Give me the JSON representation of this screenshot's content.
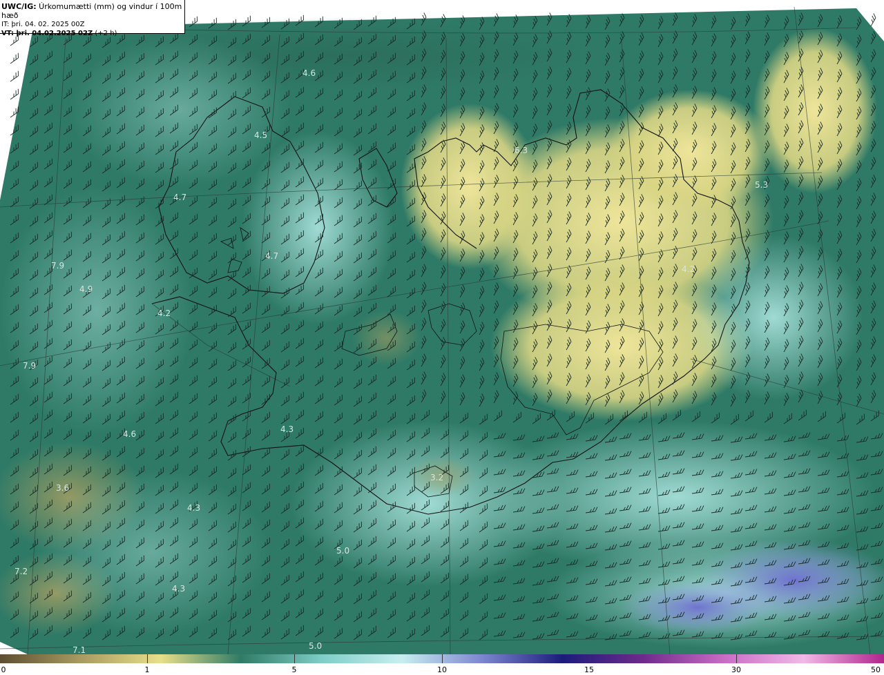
{
  "header": {
    "line1_bold": "UWC/IG:",
    "line1_rest": " Úrkomumætti (mm) og vindur í 100m hæð",
    "line2": "IT: þri. 04. 02. 2025 00Z",
    "line3_bold": "VT: þri. 04.02.2025 02Z",
    "line3_rest": " (+2 h)"
  },
  "colorbar": {
    "ticks": [
      "0",
      "1",
      "5",
      "10",
      "15",
      "30",
      "50"
    ],
    "colors": [
      "#5e4e32",
      "#a89a60",
      "#e8df8a",
      "#2f7b66",
      "#7ecdc6",
      "#c7eef0",
      "#7d86cf",
      "#1b1c7a",
      "#6e2a8a",
      "#c86bc4",
      "#f2b8e8",
      "#b0258c"
    ]
  },
  "map": {
    "colors": {
      "sea_base": "#2f7a67",
      "light_teal": "#8fd2cb",
      "yellow": "#e3da8a",
      "blue": "#8a94dc",
      "coast": "#111111",
      "barb": "#1a2a24"
    },
    "value_labels": [
      "4.6",
      "4.5",
      "6.3",
      "5.3",
      "4.7",
      "4.7",
      "7.9",
      "4.9",
      "4.2",
      "4.2",
      "7.9",
      "4.6",
      "4.3",
      "3.6",
      "4.3",
      "3.2",
      "5.0",
      "7.2",
      "4.3",
      "5.0",
      "7.1"
    ]
  }
}
